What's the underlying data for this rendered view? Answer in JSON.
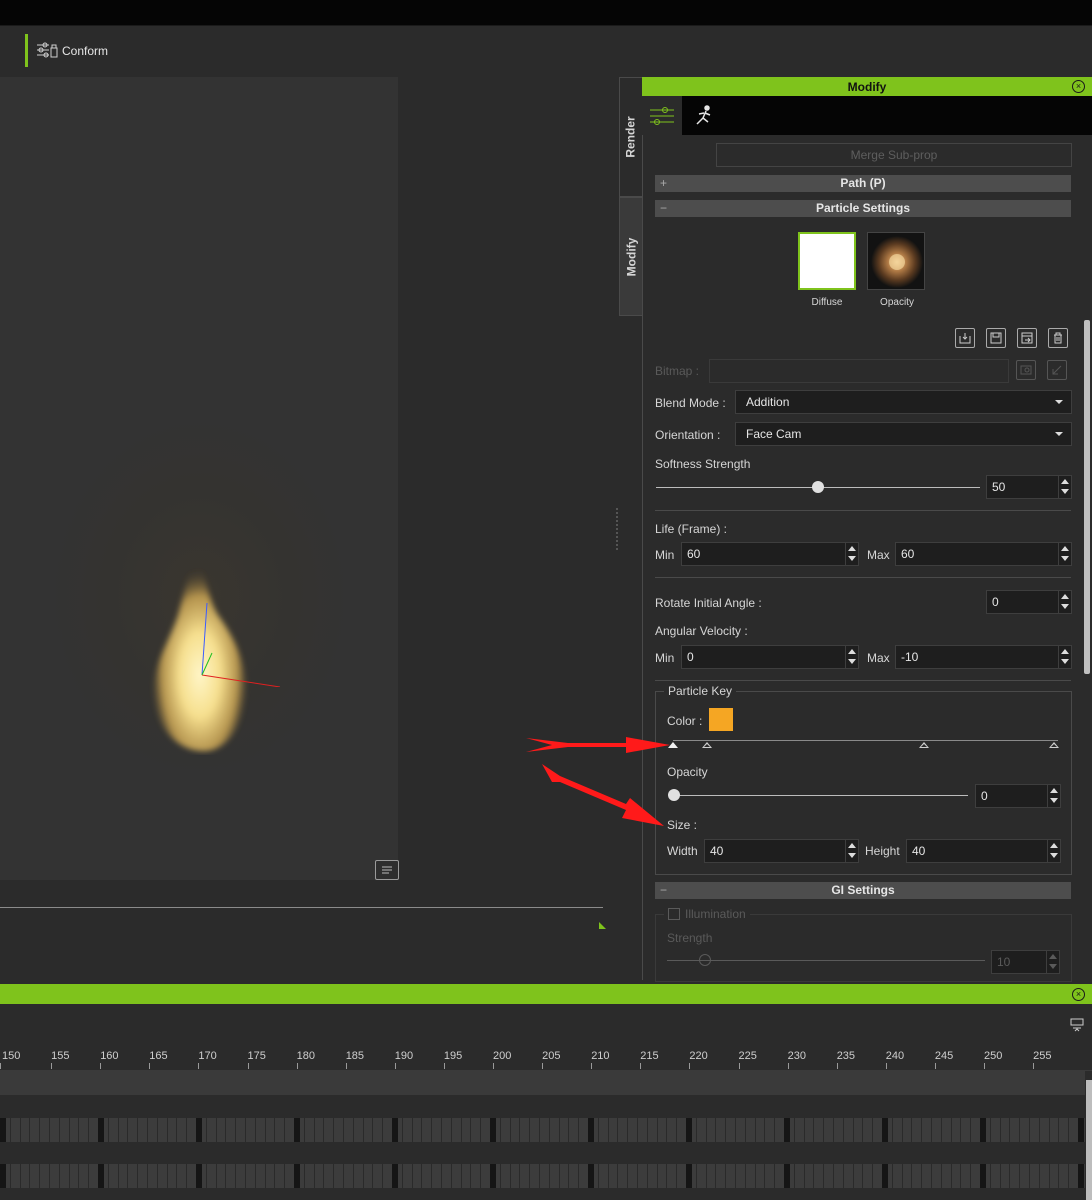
{
  "toolbar": {
    "conform_label": "Conform"
  },
  "side_tabs": [
    "Render",
    "Modify"
  ],
  "modify_panel": {
    "title": "Modify",
    "merge_button": "Merge Sub-prop",
    "sections": {
      "path": {
        "sign": "+",
        "label": "Path (P)"
      },
      "particle": {
        "sign": "−",
        "label": "Particle Settings"
      },
      "gi": {
        "sign": "−",
        "label": "GI Settings"
      }
    },
    "textures": {
      "diffuse": "Diffuse",
      "opacity": "Opacity"
    },
    "bitmap_label": "Bitmap :",
    "blend_mode": {
      "label": "Blend Mode :",
      "value": "Addition"
    },
    "orientation": {
      "label": "Orientation :",
      "value": "Face Cam"
    },
    "softness": {
      "label": "Softness Strength",
      "value": "50",
      "fraction": 0.5
    },
    "life": {
      "label": "Life (Frame) :",
      "min_label": "Min",
      "min": "60",
      "max_label": "Max",
      "max": "60"
    },
    "rotate_initial_angle": {
      "label": "Rotate Initial Angle :",
      "value": "0"
    },
    "angular_velocity": {
      "label": "Angular Velocity :",
      "min_label": "Min",
      "min": "0",
      "max_label": "Max",
      "max": "-10"
    },
    "particle_key": {
      "title": "Particle Key",
      "color_label": "Color :",
      "color": "#f5a623",
      "opacity_label": "Opacity",
      "opacity_value": "0",
      "opacity_fraction": 0.0,
      "size_label": "Size :",
      "width_label": "Width",
      "width": "40",
      "height_label": "Height",
      "height": "40"
    },
    "gi": {
      "illumination": "Illumination",
      "strength_label": "Strength",
      "strength_value": "10",
      "strength_fraction": 0.1
    }
  },
  "timeline": {
    "ticks": [
      "150",
      "155",
      "160",
      "165",
      "170",
      "175",
      "180",
      "185",
      "190",
      "195",
      "200",
      "205",
      "210",
      "215",
      "220",
      "225",
      "230",
      "235",
      "240",
      "245",
      "250",
      "255"
    ]
  },
  "colors": {
    "accent": "#7fc31c",
    "annotation_arrow": "#ff1a1a"
  }
}
